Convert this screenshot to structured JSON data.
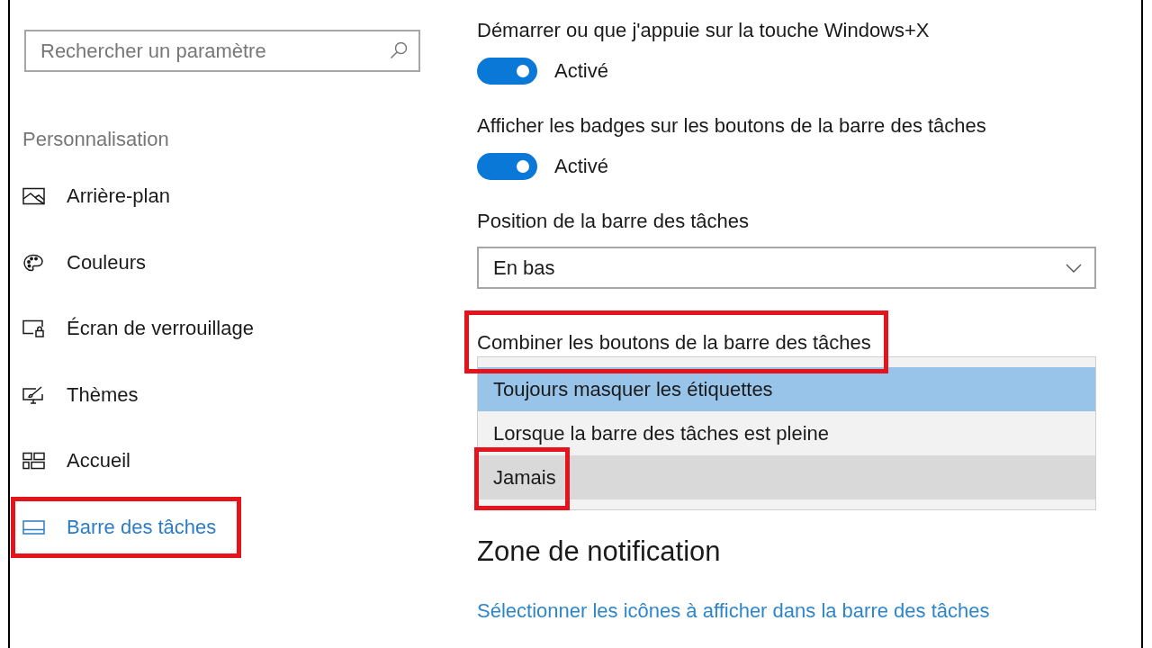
{
  "sidebar": {
    "search": {
      "placeholder": "Rechercher un paramètre"
    },
    "section_title": "Personnalisation",
    "items": [
      {
        "label": "Arrière-plan",
        "selected": false,
        "highlighted": false
      },
      {
        "label": "Couleurs",
        "selected": false,
        "highlighted": false
      },
      {
        "label": "Écran de verrouillage",
        "selected": false,
        "highlighted": false
      },
      {
        "label": "Thèmes",
        "selected": false,
        "highlighted": false
      },
      {
        "label": "Accueil",
        "selected": false,
        "highlighted": false
      },
      {
        "label": "Barre des tâches",
        "selected": true,
        "highlighted": true
      }
    ]
  },
  "settings": [
    {
      "kind": "toggle",
      "label": "Démarrer ou que j'appuie sur la touche Windows+X",
      "on": true,
      "state_text": "Activé"
    },
    {
      "kind": "toggle",
      "label": "Afficher les badges sur les boutons de la barre des tâches",
      "on": true,
      "state_text": "Activé"
    },
    {
      "kind": "dropdown",
      "label": "Position de la barre des tâches",
      "value": "En bas"
    },
    {
      "kind": "open_dropdown",
      "label": "Combiner les boutons de la barre des tâches",
      "highlighted": true,
      "options": [
        {
          "label": "Toujours masquer les étiquettes",
          "selected": true,
          "hovered": false,
          "highlighted": false
        },
        {
          "label": "Lorsque la barre des tâches est pleine",
          "selected": false,
          "hovered": false,
          "highlighted": false
        },
        {
          "label": "Jamais",
          "selected": false,
          "hovered": true,
          "highlighted": true
        }
      ]
    }
  ],
  "notification_area": {
    "heading": "Zone de notification",
    "link": "Sélectionner les icônes à afficher dans la barre des tâches"
  }
}
